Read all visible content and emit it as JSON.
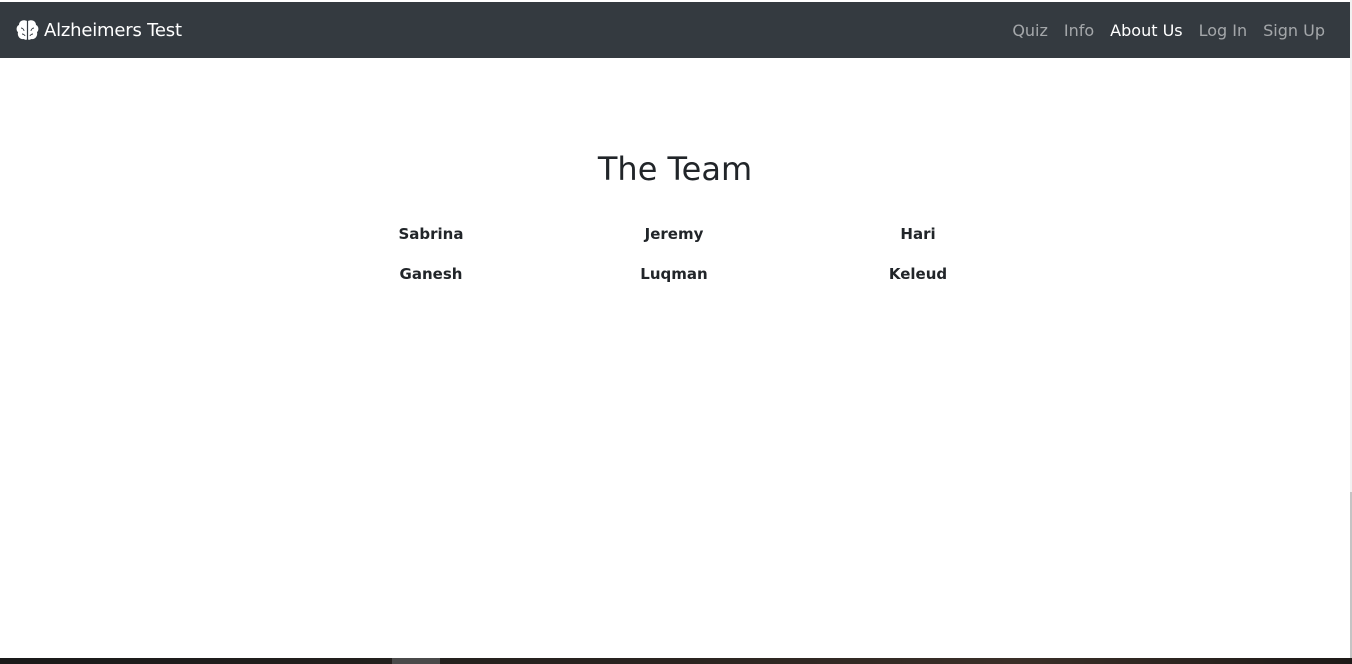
{
  "navbar": {
    "brand_icon": "brain-icon",
    "brand_text": "Alzheimers Test",
    "links": [
      {
        "label": "Quiz",
        "active": false
      },
      {
        "label": "Info",
        "active": false
      },
      {
        "label": "About Us",
        "active": true
      },
      {
        "label": "Log In",
        "active": false
      },
      {
        "label": "Sign Up",
        "active": false
      }
    ],
    "background_color": "#343a40"
  },
  "main": {
    "title": "The Team",
    "members": [
      "Sabrina",
      "Jeremy",
      "Hari",
      "Ganesh",
      "Luqman",
      "Keleud"
    ]
  }
}
